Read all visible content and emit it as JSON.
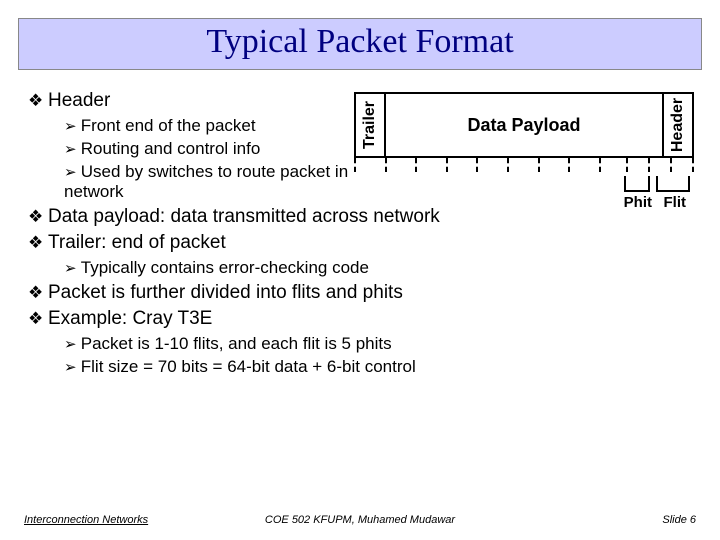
{
  "title": "Typical Packet Format",
  "bullets": {
    "header": "Header",
    "h_front": "Front end of the packet",
    "h_route": "Routing and control info",
    "h_used": "Used by switches to route packet in network",
    "payload": "Data payload: data transmitted across network",
    "trailer": "Trailer: end of packet",
    "t_err": "Typically contains error-checking code",
    "divide": "Packet is further divided into flits and phits",
    "example": "Example: Cray T3E",
    "e_pkt": "Packet is 1-10 flits, and each flit is 5 phits",
    "e_flit": "Flit size = 70 bits = 64-bit data + 6-bit control"
  },
  "packet": {
    "trailer_label": "Trailer",
    "payload_label": "Data Payload",
    "header_label": "Header",
    "phit_label": "Phit",
    "flit_label": "Flit"
  },
  "footer": {
    "left": "Interconnection Networks",
    "center": "COE 502 KFUPM, Muhamed Mudawar",
    "right": "Slide 6"
  }
}
